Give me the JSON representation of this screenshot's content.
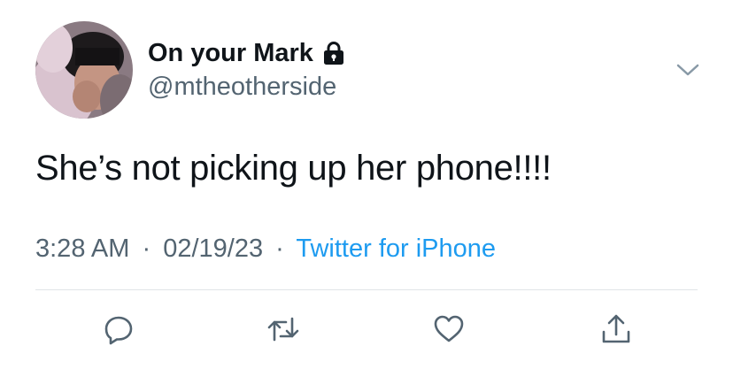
{
  "user": {
    "display_name": "On your Mark",
    "handle": "@mtheotherside",
    "avatar_icon": "profile-photo",
    "protected_icon": "lock-icon"
  },
  "tweet": {
    "text": "She’s not picking up her phone!!!!",
    "time": "3:28 AM",
    "separator": "·",
    "date": "02/19/23",
    "source": "Twitter for iPhone"
  },
  "actions": {
    "reply_icon": "reply-icon",
    "retweet_icon": "retweet-icon",
    "like_icon": "heart-icon",
    "share_icon": "share-icon"
  },
  "colors": {
    "text": "#0f1419",
    "secondary": "#536471",
    "link": "#1d9bf0",
    "divider": "#e1e5e8"
  }
}
